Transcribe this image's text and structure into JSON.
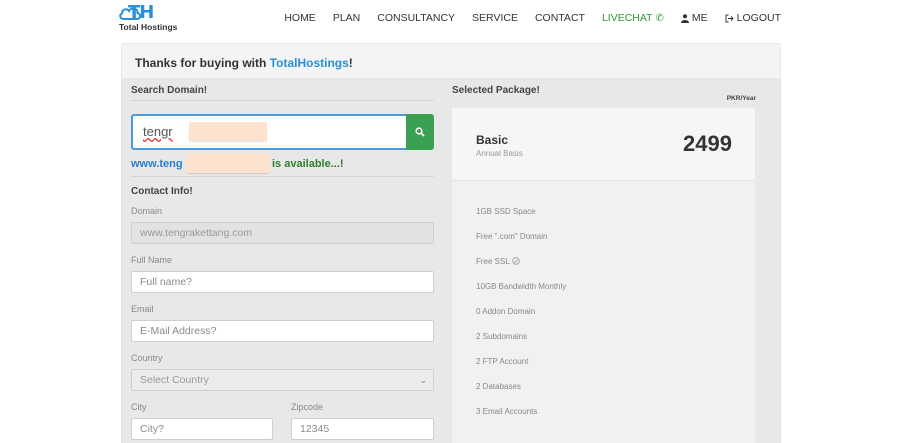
{
  "header": {
    "logo_mark": "TH",
    "logo_sub": "Total Hostings",
    "nav": [
      "HOME",
      "PLAN",
      "CONSULTANCY",
      "SERVICE",
      "CONTACT",
      "LIVECHAT",
      "ME",
      "LOGOUT"
    ],
    "livechat_color": "#2e9b2e"
  },
  "banner": {
    "prefix": "Thanks for buying with ",
    "brand": "TotalHostings",
    "suffix": "!"
  },
  "search": {
    "title": "Search Domain!",
    "value": "tengr",
    "button_icon": "search-icon",
    "avail_url": "www.teng",
    "avail_msg": "is available...!"
  },
  "contact": {
    "title": "Contact Info!",
    "domain_label": "Domain",
    "domain_value": "www.tengrakettang.com",
    "fullname_label": "Full Name",
    "fullname_placeholder": "Full name?",
    "email_label": "Email",
    "email_placeholder": "E-Mail Address?",
    "country_label": "Country",
    "country_value": "Select Country",
    "city_label": "City",
    "city_placeholder": "City?",
    "zip_label": "Zipcode",
    "zip_placeholder": "12345"
  },
  "package": {
    "title": "Selected Package!",
    "currency": "PKR/Year",
    "name": "Basic",
    "basis": "Annual Basis",
    "price": "2499",
    "features": [
      "1GB SSD Space",
      "Free \".com\" Domain",
      "Free SSL",
      "10GB Bandwidth Monthly",
      "0 Addon Domain",
      "2 Subdomains",
      "2 FTP Account",
      "2 Databases",
      "3 Email Accounts"
    ]
  },
  "colors": {
    "brand_blue": "#2a8fd6",
    "search_button": "#3aa153",
    "available": "#2e7f2e"
  }
}
